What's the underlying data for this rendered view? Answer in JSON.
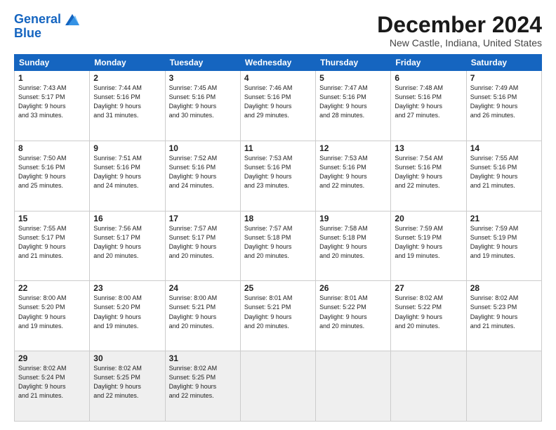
{
  "header": {
    "logo_line1": "General",
    "logo_line2": "Blue",
    "month": "December 2024",
    "location": "New Castle, Indiana, United States"
  },
  "weekdays": [
    "Sunday",
    "Monday",
    "Tuesday",
    "Wednesday",
    "Thursday",
    "Friday",
    "Saturday"
  ],
  "weeks": [
    [
      {
        "day": "1",
        "info": "Sunrise: 7:43 AM\nSunset: 5:17 PM\nDaylight: 9 hours\nand 33 minutes."
      },
      {
        "day": "2",
        "info": "Sunrise: 7:44 AM\nSunset: 5:16 PM\nDaylight: 9 hours\nand 31 minutes."
      },
      {
        "day": "3",
        "info": "Sunrise: 7:45 AM\nSunset: 5:16 PM\nDaylight: 9 hours\nand 30 minutes."
      },
      {
        "day": "4",
        "info": "Sunrise: 7:46 AM\nSunset: 5:16 PM\nDaylight: 9 hours\nand 29 minutes."
      },
      {
        "day": "5",
        "info": "Sunrise: 7:47 AM\nSunset: 5:16 PM\nDaylight: 9 hours\nand 28 minutes."
      },
      {
        "day": "6",
        "info": "Sunrise: 7:48 AM\nSunset: 5:16 PM\nDaylight: 9 hours\nand 27 minutes."
      },
      {
        "day": "7",
        "info": "Sunrise: 7:49 AM\nSunset: 5:16 PM\nDaylight: 9 hours\nand 26 minutes."
      }
    ],
    [
      {
        "day": "8",
        "info": "Sunrise: 7:50 AM\nSunset: 5:16 PM\nDaylight: 9 hours\nand 25 minutes."
      },
      {
        "day": "9",
        "info": "Sunrise: 7:51 AM\nSunset: 5:16 PM\nDaylight: 9 hours\nand 24 minutes."
      },
      {
        "day": "10",
        "info": "Sunrise: 7:52 AM\nSunset: 5:16 PM\nDaylight: 9 hours\nand 24 minutes."
      },
      {
        "day": "11",
        "info": "Sunrise: 7:53 AM\nSunset: 5:16 PM\nDaylight: 9 hours\nand 23 minutes."
      },
      {
        "day": "12",
        "info": "Sunrise: 7:53 AM\nSunset: 5:16 PM\nDaylight: 9 hours\nand 22 minutes."
      },
      {
        "day": "13",
        "info": "Sunrise: 7:54 AM\nSunset: 5:16 PM\nDaylight: 9 hours\nand 22 minutes."
      },
      {
        "day": "14",
        "info": "Sunrise: 7:55 AM\nSunset: 5:16 PM\nDaylight: 9 hours\nand 21 minutes."
      }
    ],
    [
      {
        "day": "15",
        "info": "Sunrise: 7:55 AM\nSunset: 5:17 PM\nDaylight: 9 hours\nand 21 minutes."
      },
      {
        "day": "16",
        "info": "Sunrise: 7:56 AM\nSunset: 5:17 PM\nDaylight: 9 hours\nand 20 minutes."
      },
      {
        "day": "17",
        "info": "Sunrise: 7:57 AM\nSunset: 5:17 PM\nDaylight: 9 hours\nand 20 minutes."
      },
      {
        "day": "18",
        "info": "Sunrise: 7:57 AM\nSunset: 5:18 PM\nDaylight: 9 hours\nand 20 minutes."
      },
      {
        "day": "19",
        "info": "Sunrise: 7:58 AM\nSunset: 5:18 PM\nDaylight: 9 hours\nand 20 minutes."
      },
      {
        "day": "20",
        "info": "Sunrise: 7:59 AM\nSunset: 5:19 PM\nDaylight: 9 hours\nand 19 minutes."
      },
      {
        "day": "21",
        "info": "Sunrise: 7:59 AM\nSunset: 5:19 PM\nDaylight: 9 hours\nand 19 minutes."
      }
    ],
    [
      {
        "day": "22",
        "info": "Sunrise: 8:00 AM\nSunset: 5:20 PM\nDaylight: 9 hours\nand 19 minutes."
      },
      {
        "day": "23",
        "info": "Sunrise: 8:00 AM\nSunset: 5:20 PM\nDaylight: 9 hours\nand 19 minutes."
      },
      {
        "day": "24",
        "info": "Sunrise: 8:00 AM\nSunset: 5:21 PM\nDaylight: 9 hours\nand 20 minutes."
      },
      {
        "day": "25",
        "info": "Sunrise: 8:01 AM\nSunset: 5:21 PM\nDaylight: 9 hours\nand 20 minutes."
      },
      {
        "day": "26",
        "info": "Sunrise: 8:01 AM\nSunset: 5:22 PM\nDaylight: 9 hours\nand 20 minutes."
      },
      {
        "day": "27",
        "info": "Sunrise: 8:02 AM\nSunset: 5:22 PM\nDaylight: 9 hours\nand 20 minutes."
      },
      {
        "day": "28",
        "info": "Sunrise: 8:02 AM\nSunset: 5:23 PM\nDaylight: 9 hours\nand 21 minutes."
      }
    ],
    [
      {
        "day": "29",
        "info": "Sunrise: 8:02 AM\nSunset: 5:24 PM\nDaylight: 9 hours\nand 21 minutes."
      },
      {
        "day": "30",
        "info": "Sunrise: 8:02 AM\nSunset: 5:25 PM\nDaylight: 9 hours\nand 22 minutes."
      },
      {
        "day": "31",
        "info": "Sunrise: 8:02 AM\nSunset: 5:25 PM\nDaylight: 9 hours\nand 22 minutes."
      },
      {
        "day": "",
        "info": ""
      },
      {
        "day": "",
        "info": ""
      },
      {
        "day": "",
        "info": ""
      },
      {
        "day": "",
        "info": ""
      }
    ]
  ]
}
